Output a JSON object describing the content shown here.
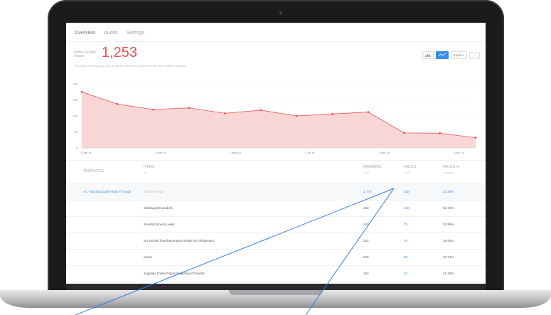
{
  "tabs": [
    {
      "label": "Overview"
    },
    {
      "label": "Audits"
    },
    {
      "label": "Settings"
    }
  ],
  "kpi": {
    "label": "TOTAL FAILED ITEMS",
    "value": "1,253",
    "description": "This graph displays how your audits are performing based on how many failures occured"
  },
  "controls": {
    "export_label": "Export"
  },
  "chart_data": {
    "type": "area",
    "color": "#e45453",
    "fill": "#f8d6d6",
    "ylim": [
      0,
      200
    ],
    "yticks": [
      0,
      50,
      100,
      150,
      200
    ],
    "x_labels": [
      "1 Jan 18",
      "1 Mar 18",
      "1 May 18",
      "1 Jul 18",
      "1 Sep 18",
      "1 Nov 18"
    ],
    "values": [
      175,
      137,
      120,
      125,
      108,
      118,
      100,
      106,
      112,
      47,
      46,
      32
    ]
  },
  "table": {
    "headers": {
      "templates": "TEMPLATES",
      "items": "ITEMS",
      "items_sub": "All",
      "answers": "ANSWERS",
      "answers_sub": "Total",
      "failed": "FAILED",
      "failed_sub": "Total",
      "failed_pct": "FAILED %",
      "failed_pct_sub": "Average"
    },
    "summary": {
      "template": "Au - Morning Daily Walk Through",
      "item": "Total Average",
      "answers": "2,776",
      "failed": "528",
      "failed_pct": "24.26%"
    },
    "rows": [
      {
        "item": "Walkways/Corridors",
        "answers": "242",
        "failed": "130",
        "failed_pct": "53.72%"
      },
      {
        "item": "Smells/Odours/Leaks",
        "answers": "242",
        "failed": "75",
        "failed_pct": "30.99%"
      },
      {
        "item": "No spoiled food/beverages inside the refrigerator",
        "answers": "242",
        "failed": "70",
        "failed_pct": "28.93%"
      },
      {
        "item": "Clean",
        "answers": "242",
        "failed": "66",
        "failed_pct": "27.27%"
      },
      {
        "item": "Supplies (Toilet Paper/Soap/Hand Towels)",
        "answers": "242",
        "failed": "52",
        "failed_pct": "21.49%"
      }
    ]
  }
}
